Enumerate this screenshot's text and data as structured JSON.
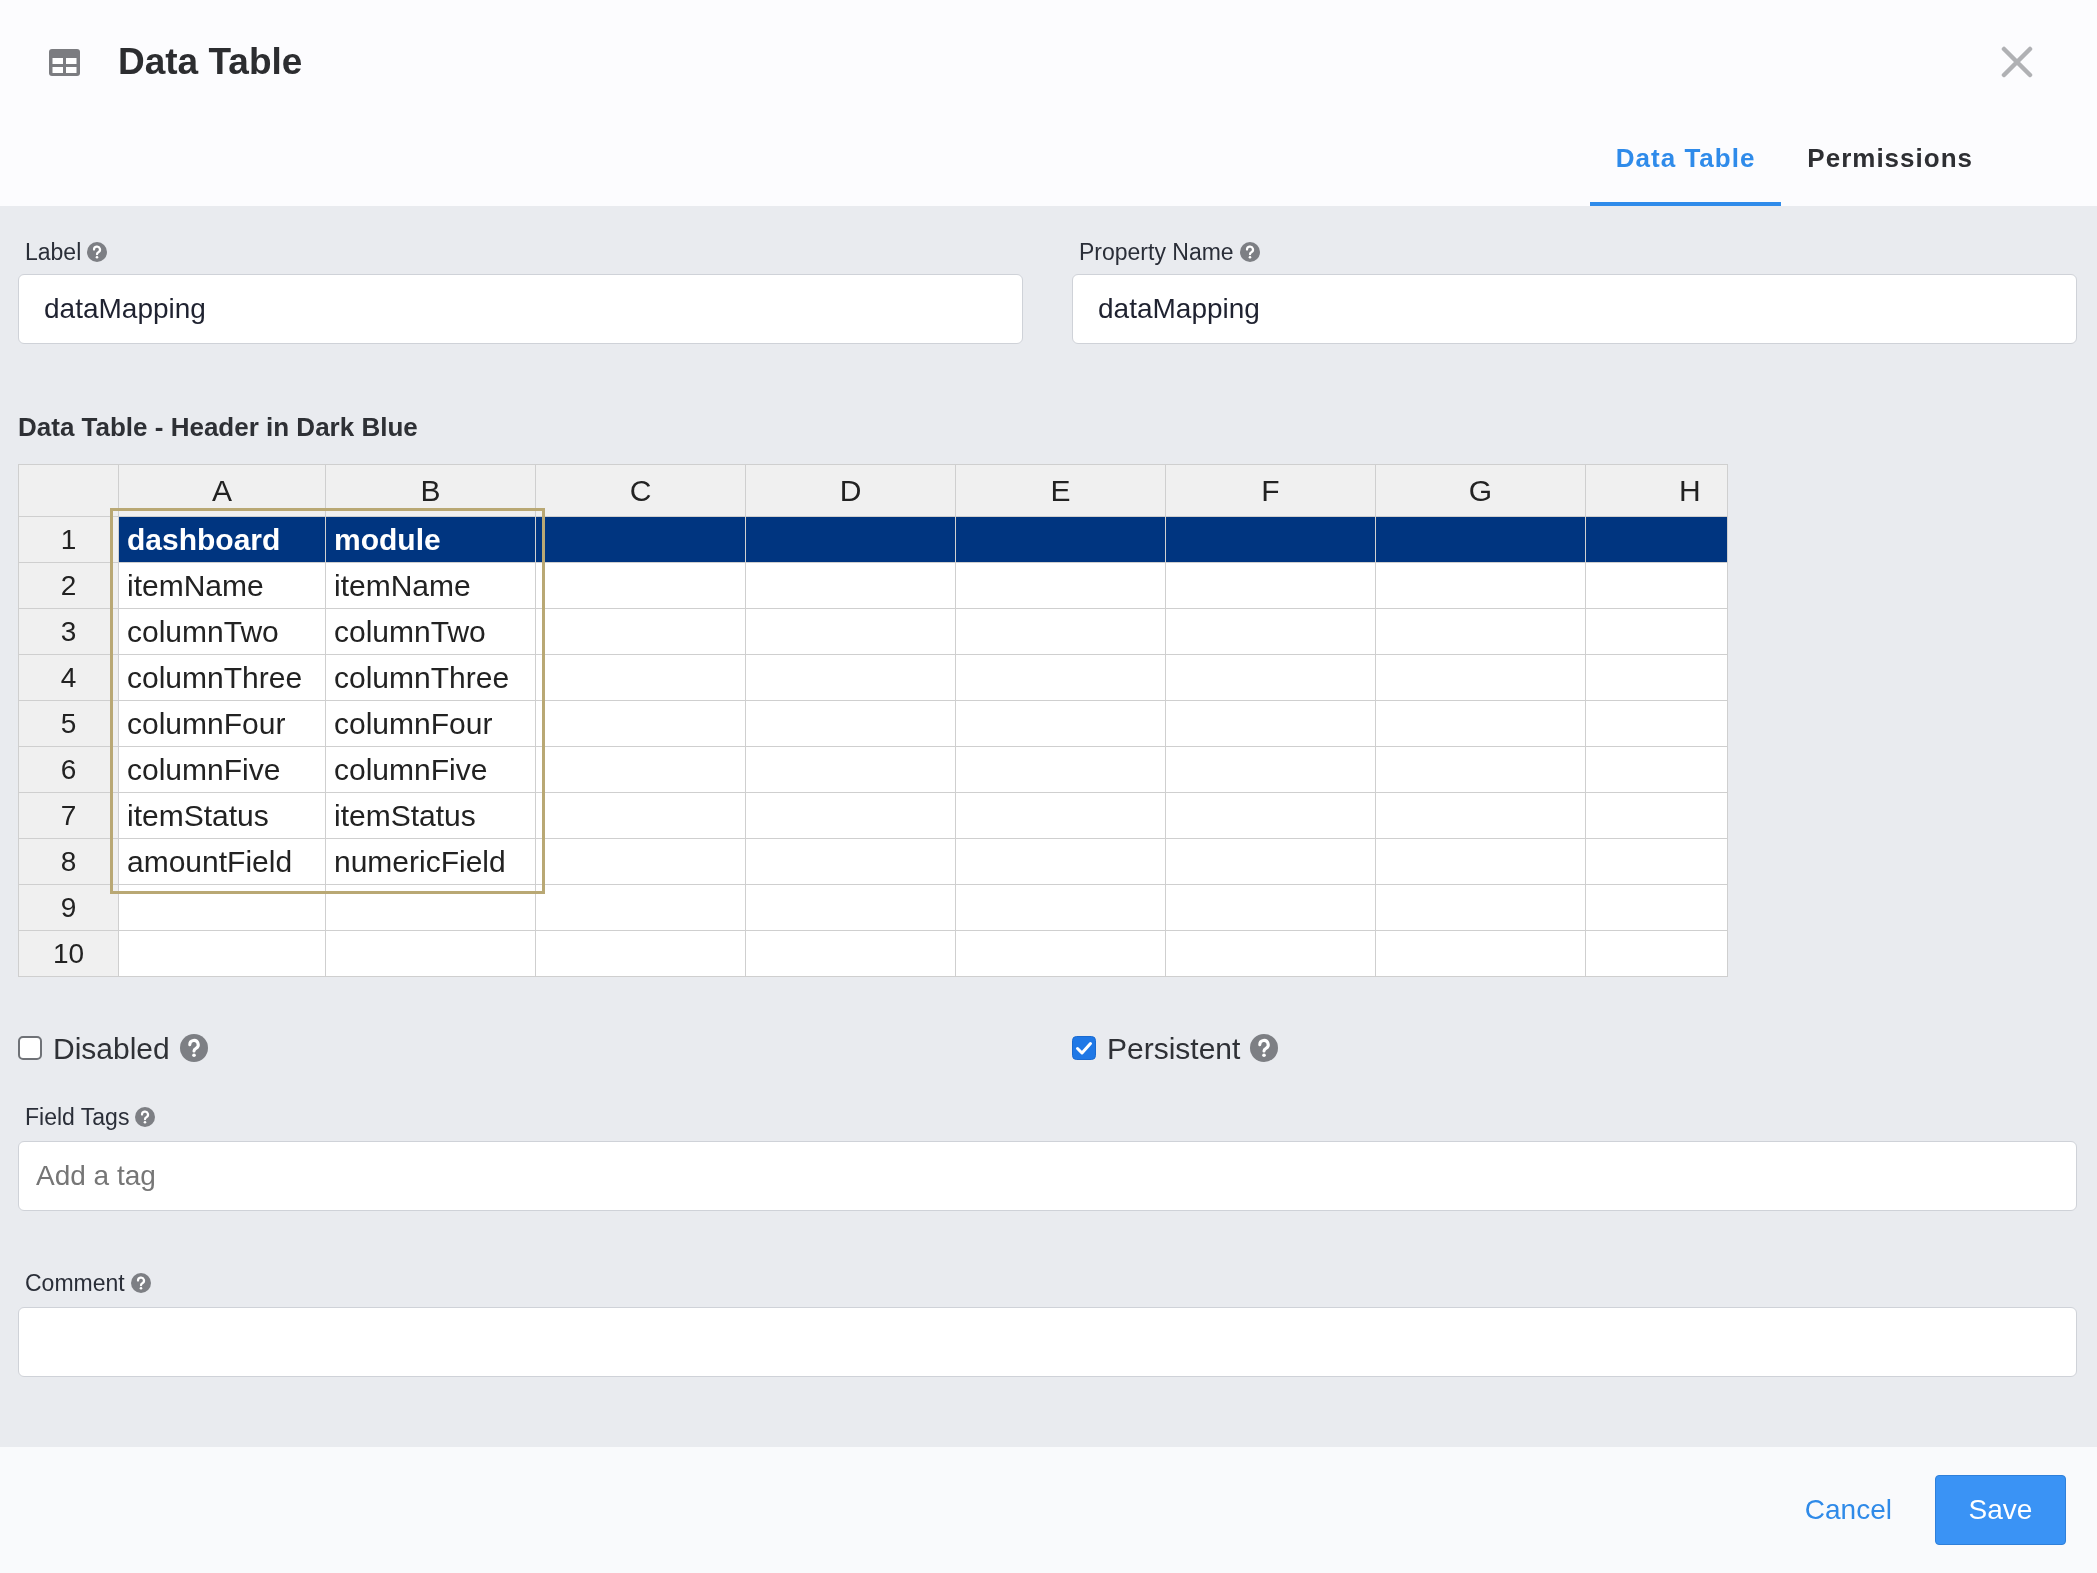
{
  "dialog": {
    "title": "Data Table",
    "tabs": [
      {
        "label": "Data Table",
        "selected": true
      },
      {
        "label": "Permissions",
        "selected": false
      }
    ]
  },
  "fields": [
    {
      "label": "Label",
      "value": "dataMapping"
    },
    {
      "label": "Property Name",
      "value": "dataMapping"
    }
  ],
  "data_table": {
    "title": "Data Table - Header in Dark Blue",
    "column_headers": [
      "A",
      "B",
      "C",
      "D",
      "E",
      "F",
      "G",
      "H"
    ],
    "filled_range_selected": true,
    "rows": [
      {
        "number": "1",
        "header": true,
        "cells": [
          "dashboard",
          "module"
        ]
      },
      {
        "number": "2",
        "header": false,
        "cells": [
          "itemName",
          "itemName"
        ]
      },
      {
        "number": "3",
        "header": false,
        "cells": [
          "columnTwo",
          "columnTwo"
        ]
      },
      {
        "number": "4",
        "header": false,
        "cells": [
          "columnThree",
          "columnThree"
        ]
      },
      {
        "number": "5",
        "header": false,
        "cells": [
          "columnFour",
          "columnFour"
        ]
      },
      {
        "number": "6",
        "header": false,
        "cells": [
          "columnFive",
          "columnFive"
        ]
      },
      {
        "number": "7",
        "header": false,
        "cells": [
          "itemStatus",
          "itemStatus"
        ]
      },
      {
        "number": "8",
        "header": false,
        "cells": [
          "amountField",
          "numericField"
        ]
      },
      {
        "number": "9",
        "header": false
      },
      {
        "number": "10",
        "header": false
      }
    ]
  },
  "checkboxes": [
    {
      "label": "Disabled",
      "checked": false
    },
    {
      "label": "Persistent",
      "checked": true
    }
  ],
  "field_tags": {
    "label": "Field Tags",
    "placeholder": "Add a tag"
  },
  "comment": {
    "label": "Comment"
  },
  "footer": {
    "cancel": "Cancel",
    "save": "Save"
  }
}
